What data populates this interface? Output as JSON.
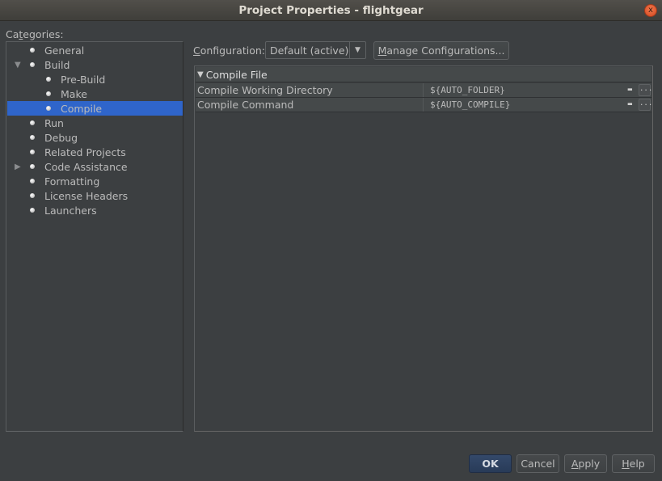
{
  "window": {
    "title": "Project Properties - flightgear",
    "close_glyph": "x"
  },
  "categories": {
    "label_pre": "Ca",
    "label_mnemonic": "t",
    "label_post": "egories:",
    "items": [
      {
        "label": "General",
        "level": 0,
        "expander": "",
        "selected": false
      },
      {
        "label": "Build",
        "level": 0,
        "expander": "▼",
        "selected": false
      },
      {
        "label": "Pre-Build",
        "level": 1,
        "expander": "",
        "selected": false
      },
      {
        "label": "Make",
        "level": 1,
        "expander": "",
        "selected": false
      },
      {
        "label": "Compile",
        "level": 1,
        "expander": "",
        "selected": true
      },
      {
        "label": "Run",
        "level": 0,
        "expander": "",
        "selected": false
      },
      {
        "label": "Debug",
        "level": 0,
        "expander": "",
        "selected": false
      },
      {
        "label": "Related Projects",
        "level": 0,
        "expander": "",
        "selected": false
      },
      {
        "label": "Code Assistance",
        "level": 0,
        "expander": "▶",
        "selected": false
      },
      {
        "label": "Formatting",
        "level": 0,
        "expander": "",
        "selected": false
      },
      {
        "label": "License Headers",
        "level": 0,
        "expander": "",
        "selected": false
      },
      {
        "label": "Launchers",
        "level": 0,
        "expander": "",
        "selected": false
      }
    ]
  },
  "configuration": {
    "label_mnemonic": "C",
    "label_rest": "onfiguration:",
    "selected": "Default (active)",
    "dropdown_glyph": "▼",
    "manage_mnemonic": "M",
    "manage_rest": "anage Configurations..."
  },
  "properties": {
    "section_glyph": "▼",
    "section_title": "Compile File",
    "rows": [
      {
        "name": "Compile Working Directory",
        "value": "${AUTO_FOLDER}"
      },
      {
        "name": "Compile Command",
        "value": "${AUTO_COMPILE}"
      }
    ],
    "edit_glyph": "▬",
    "more_glyph": "..."
  },
  "buttons": {
    "ok": "OK",
    "cancel": "Cancel",
    "apply_mnemonic": "A",
    "apply_rest": "pply",
    "help_mnemonic": "H",
    "help_rest": "elp"
  }
}
